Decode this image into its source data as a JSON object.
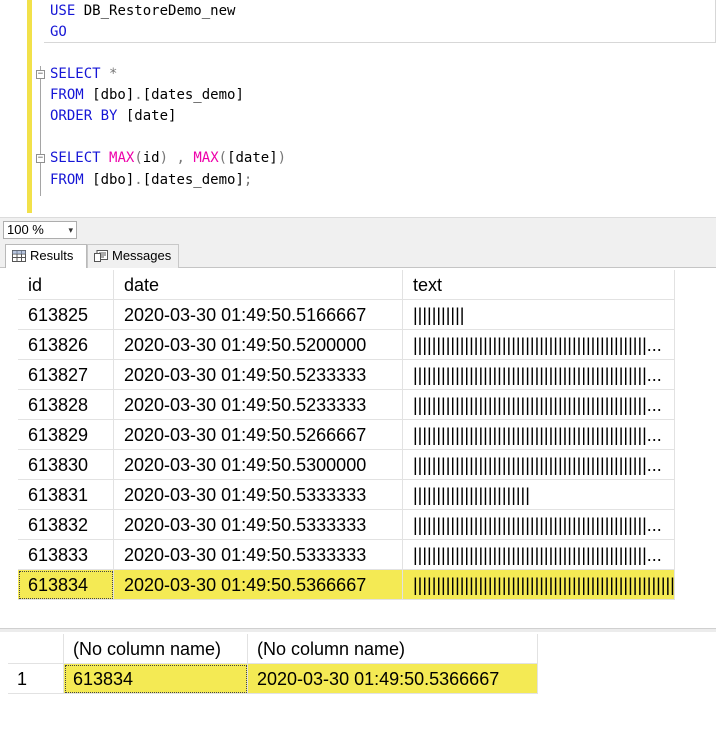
{
  "editor": {
    "lines": [
      {
        "parts": [
          {
            "t": "USE",
            "c": "kw"
          },
          {
            "t": " DB_RestoreDemo_new",
            "c": "tx"
          }
        ]
      },
      {
        "parts": [
          {
            "t": "GO",
            "c": "kw"
          }
        ]
      },
      {
        "parts": [
          {
            "t": "SELECT",
            "c": "kw"
          },
          {
            "t": " *",
            "c": "gr"
          }
        ]
      },
      {
        "parts": [
          {
            "t": "FROM",
            "c": "kw"
          },
          {
            "t": " [dbo]",
            "c": "tx"
          },
          {
            "t": ".",
            "c": "gr"
          },
          {
            "t": "[dates_demo]",
            "c": "tx"
          }
        ]
      },
      {
        "parts": [
          {
            "t": "ORDER BY",
            "c": "kw"
          },
          {
            "t": " [date]",
            "c": "tx"
          }
        ]
      },
      {
        "parts": [
          {
            "t": "SELECT",
            "c": "kw"
          },
          {
            "t": " ",
            "c": "tx"
          },
          {
            "t": "MAX",
            "c": "fn"
          },
          {
            "t": "(",
            "c": "gr"
          },
          {
            "t": "id",
            "c": "tx"
          },
          {
            "t": ")",
            "c": "gr"
          },
          {
            "t": " , ",
            "c": "gr"
          },
          {
            "t": "MAX",
            "c": "fn"
          },
          {
            "t": "(",
            "c": "gr"
          },
          {
            "t": "[date]",
            "c": "tx"
          },
          {
            "t": ")",
            "c": "gr"
          }
        ]
      },
      {
        "parts": [
          {
            "t": "FROM",
            "c": "kw"
          },
          {
            "t": " [dbo]",
            "c": "tx"
          },
          {
            "t": ".",
            "c": "gr"
          },
          {
            "t": "[dates_demo]",
            "c": "tx"
          },
          {
            "t": ";",
            "c": "gr"
          }
        ]
      }
    ],
    "fold_glyph": "−",
    "cursor_glyph": "I"
  },
  "zoom": {
    "value": "100 %",
    "arrow": "▾"
  },
  "tabs": [
    {
      "label": "Results",
      "active": true
    },
    {
      "label": "Messages",
      "active": false
    }
  ],
  "grid1": {
    "headers": [
      "id",
      "date",
      "text"
    ],
    "rows": [
      {
        "id": "613825",
        "date": "2020-03-30 01:49:50.5166667",
        "text": "|||||||||||"
      },
      {
        "id": "613826",
        "date": "2020-03-30 01:49:50.5200000",
        "text": "||||||||||||||||||||||||||||||||||||||||||||||||||..."
      },
      {
        "id": "613827",
        "date": "2020-03-30 01:49:50.5233333",
        "text": "||||||||||||||||||||||||||||||||||||||||||||||||||..."
      },
      {
        "id": "613828",
        "date": "2020-03-30 01:49:50.5233333",
        "text": "||||||||||||||||||||||||||||||||||||||||||||||||||..."
      },
      {
        "id": "613829",
        "date": "2020-03-30 01:49:50.5266667",
        "text": "||||||||||||||||||||||||||||||||||||||||||||||||||..."
      },
      {
        "id": "613830",
        "date": "2020-03-30 01:49:50.5300000",
        "text": "||||||||||||||||||||||||||||||||||||||||||||||||||..."
      },
      {
        "id": "613831",
        "date": "2020-03-30 01:49:50.5333333",
        "text": "|||||||||||||||||||||||||"
      },
      {
        "id": "613832",
        "date": "2020-03-30 01:49:50.5333333",
        "text": "||||||||||||||||||||||||||||||||||||||||||||||||||..."
      },
      {
        "id": "613833",
        "date": "2020-03-30 01:49:50.5333333",
        "text": "||||||||||||||||||||||||||||||||||||||||||||||||||..."
      },
      {
        "id": "613834",
        "date": "2020-03-30 01:49:50.5366667",
        "text": "||||||||||||||||||||||||||||||||||||||||||||||||||||||||",
        "selected": true
      }
    ]
  },
  "grid2": {
    "headers": [
      "",
      "(No column name)",
      "(No column name)"
    ],
    "rows": [
      {
        "num": "1",
        "a": "613834",
        "b": "2020-03-30 01:49:50.5366667",
        "selected": true
      }
    ]
  },
  "colors": {
    "highlight": "#f4ea54",
    "keyword": "#1515d6",
    "function": "#ee00aa",
    "editor_margin": "#f2e14a"
  }
}
